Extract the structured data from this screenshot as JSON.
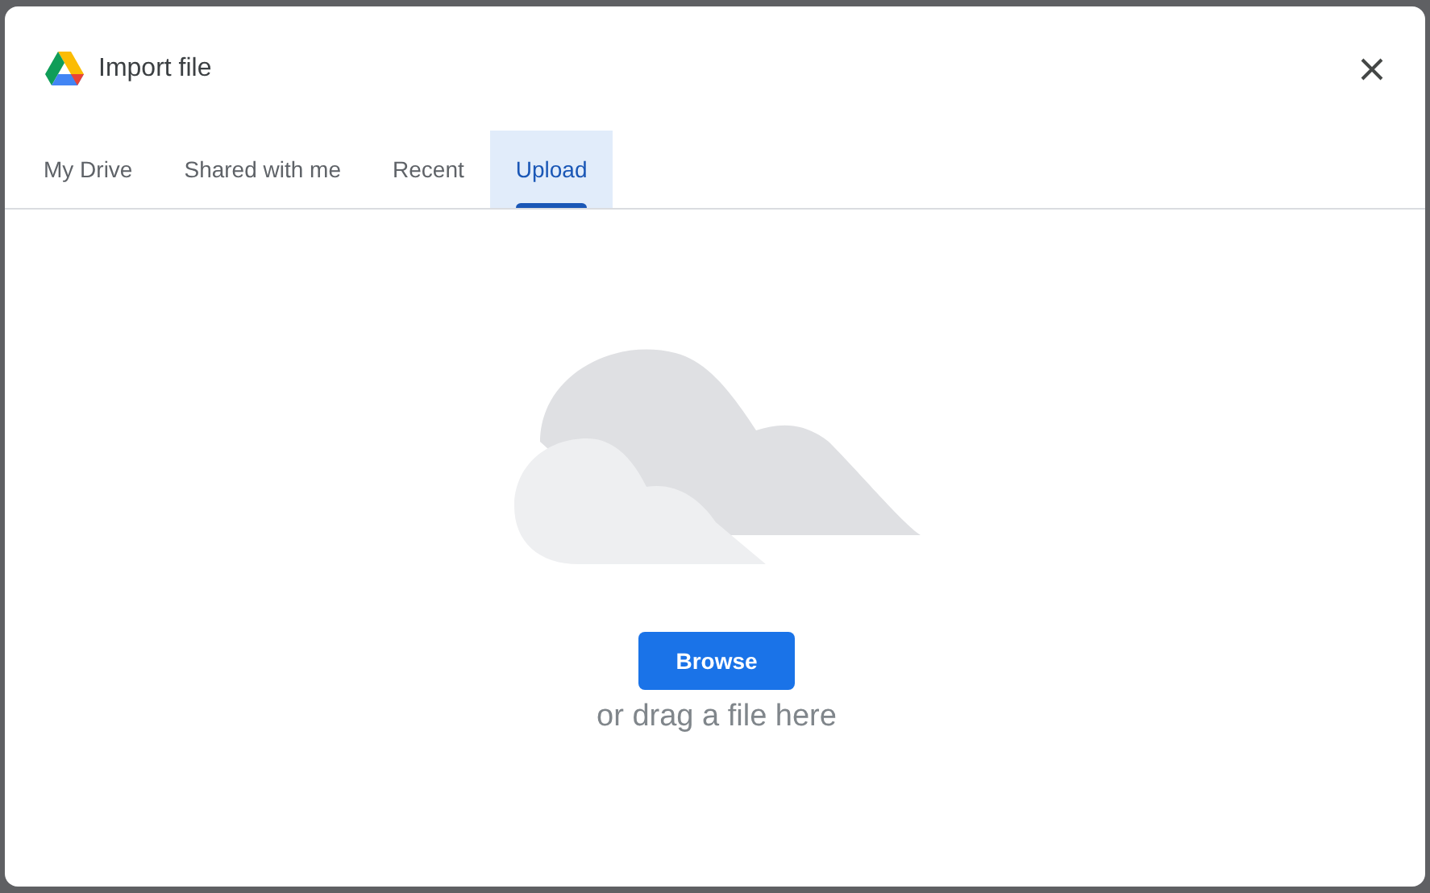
{
  "dialog": {
    "title": "Import file"
  },
  "tabs": [
    {
      "label": "My Drive",
      "selected": false
    },
    {
      "label": "Shared with me",
      "selected": false
    },
    {
      "label": "Recent",
      "selected": false
    },
    {
      "label": "Upload",
      "selected": true
    }
  ],
  "upload": {
    "button": "Browse",
    "hint": "or drag a file here"
  }
}
